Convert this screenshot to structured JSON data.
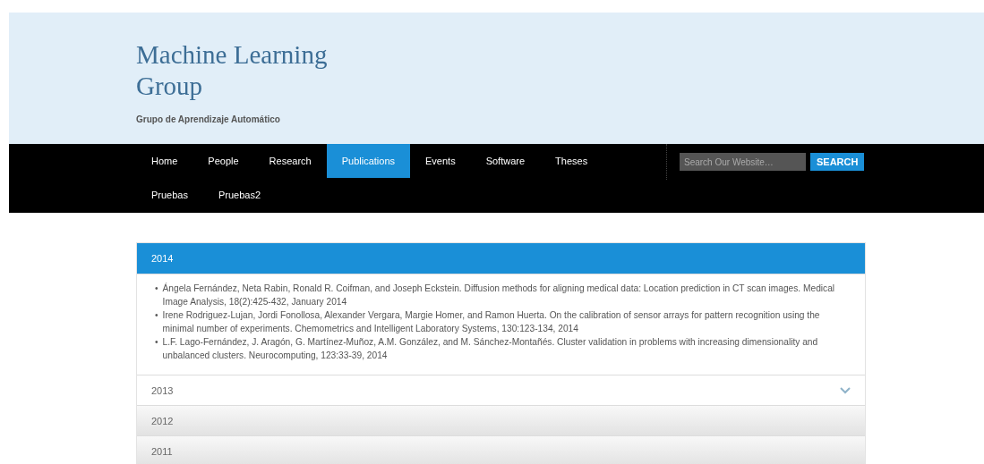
{
  "site": {
    "title": "Machine Learning Group",
    "tagline": "Grupo de Aprendizaje Automático"
  },
  "nav": {
    "items": [
      {
        "label": "Home",
        "selected": false
      },
      {
        "label": "People",
        "selected": false
      },
      {
        "label": "Research",
        "selected": false
      },
      {
        "label": "Publications",
        "selected": true
      },
      {
        "label": "Events",
        "selected": false
      },
      {
        "label": "Software",
        "selected": false
      },
      {
        "label": "Theses",
        "selected": false
      },
      {
        "label": "Pruebas",
        "selected": false
      },
      {
        "label": "Pruebas2",
        "selected": false
      }
    ],
    "search": {
      "placeholder": "Search Our Website…",
      "button": "SEARCH"
    }
  },
  "years": [
    {
      "label": "2014",
      "expanded": true,
      "highlighted": false,
      "bullet": "•",
      "publications": [
        "Ángela Fernández, Neta Rabin, Ronald R. Coifman, and Joseph Eckstein. Diffusion methods for aligning medical data: Location prediction in CT scan images. Medical Image Analysis, 18(2):425-432, January 2014",
        "Irene Rodriguez-Lujan, Jordi Fonollosa, Alexander Vergara, Margie Homer, and Ramon Huerta. On the calibration of sensor arrays for pattern recognition using the minimal number of experiments. Chemometrics and Intelligent Laboratory Systems, 130:123-134, 2014",
        "L.F. Lago-Fernández, J. Aragón, G. Martínez-Muñoz, A.M. González, and M. Sánchez-Montañés. Cluster validation in problems with increasing dimensionality and unbalanced clusters. Neurocomputing, 123:33-39, 2014"
      ]
    },
    {
      "label": "2013",
      "expanded": false,
      "highlighted": true
    },
    {
      "label": "2012",
      "expanded": false,
      "highlighted": false
    },
    {
      "label": "2011",
      "expanded": false,
      "highlighted": false
    }
  ]
}
